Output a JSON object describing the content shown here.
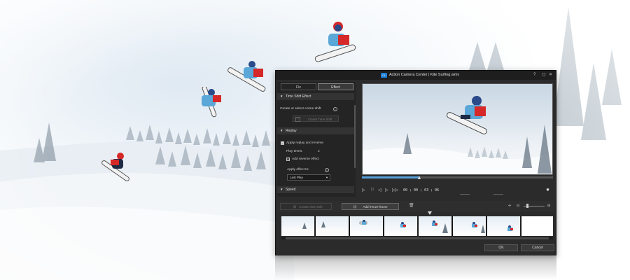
{
  "window": {
    "title": "Action Camera Center  |  Kite Surfing.wmv",
    "help": "?",
    "minimize": "▢",
    "close": "✕",
    "logo_text": "CL"
  },
  "tabs": [
    {
      "label": "Fix",
      "active": false
    },
    {
      "label": "Effect",
      "active": true
    }
  ],
  "panel": {
    "time_shift_header": "Time Shift Effect",
    "create_label": "Create or select a time shift",
    "create_button": "Create Time Shift",
    "replay_header": "Replay",
    "apply_replay_label": "Apply replay and reverse",
    "apply_replay_checked": true,
    "play_times_label": "Play times:",
    "play_times_value": "2",
    "add_reverse_label": "Add reverse effect",
    "add_reverse_checked": false,
    "apply_effect_label": "Apply effect to:",
    "apply_effect_value": "Last Play",
    "speed_header": "Speed"
  },
  "player": {
    "timecode": "00 ; 00 ; 03 ; 06",
    "progress": 0.3
  },
  "toolbar": {
    "create_time_shift": "Create time shift",
    "add_freeze_frame": "Add freeze frame"
  },
  "filmstrip": {
    "frame_count": 8
  },
  "footer": {
    "ok": "OK",
    "cancel": "Cancel"
  },
  "colors": {
    "accent": "#5aa0d8",
    "window_bg": "#2b2b2b",
    "snowboarder_jacket": "#d62828"
  },
  "icons": [
    "play-icon",
    "stop-icon",
    "prev-frame-icon",
    "next-frame-icon",
    "fast-forward-icon",
    "settings-icon",
    "trash-icon",
    "freeze-frame-icon",
    "info-icon"
  ]
}
